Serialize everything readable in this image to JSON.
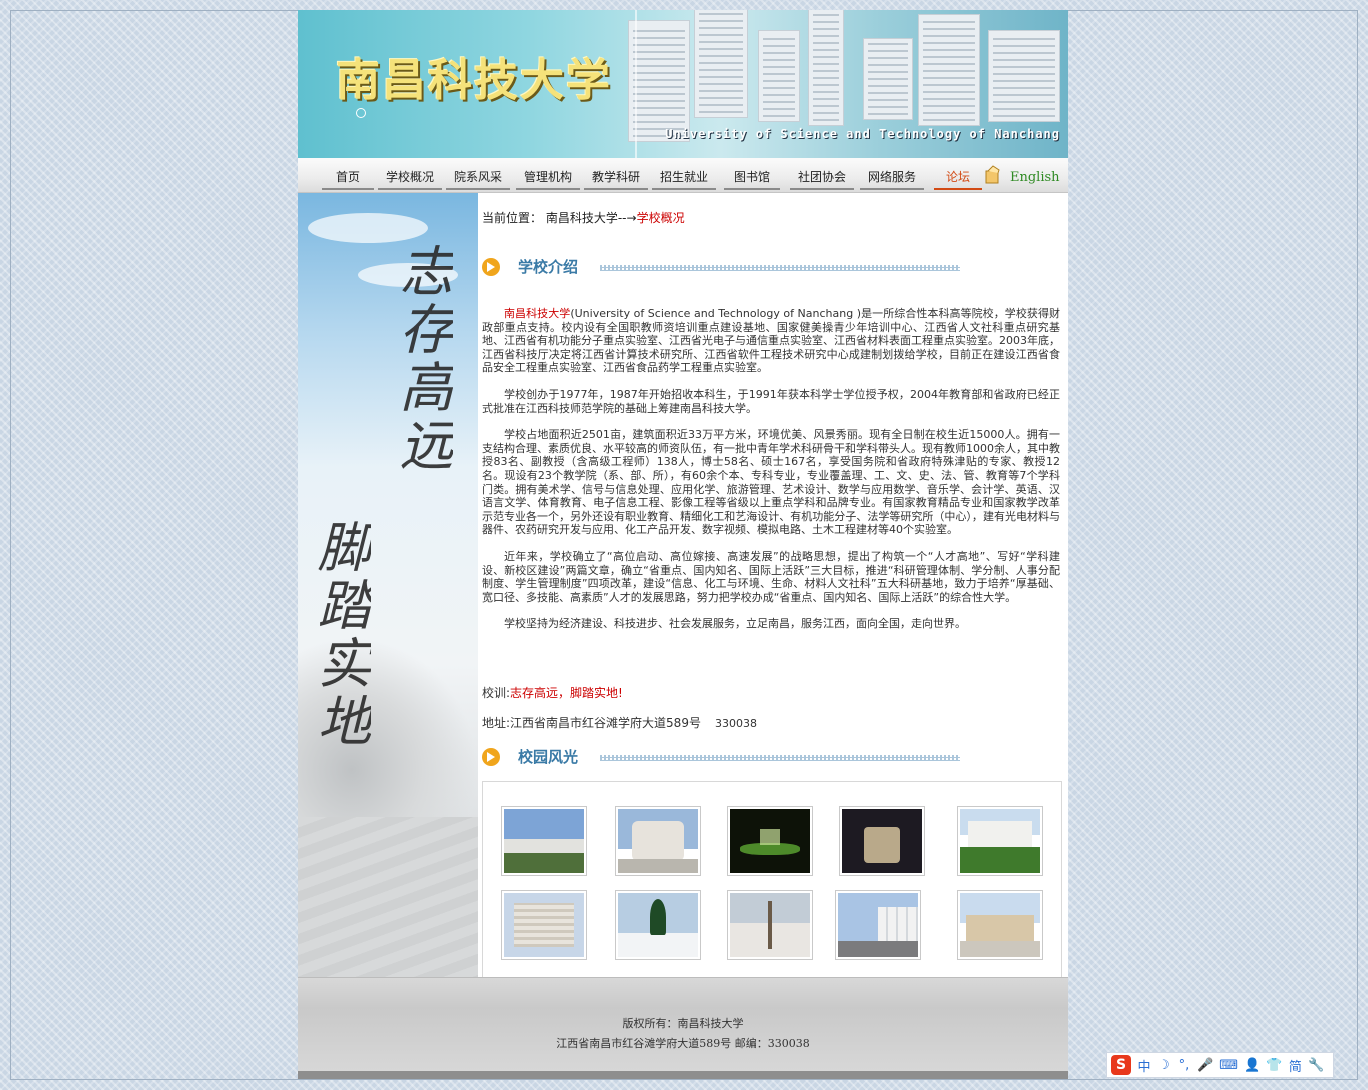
{
  "banner": {
    "title": "南昌科技大学",
    "title_en": "University of Science and Technology of Nanchang"
  },
  "nav": {
    "items": [
      "首页",
      "学校概况",
      "院系风采",
      "管理机构",
      "教学科研",
      "招生就业",
      "图书馆",
      "社团协会",
      "网络服务",
      "论坛"
    ],
    "english": "English"
  },
  "breadcrumb": {
    "label": "当前位置：",
    "parent": "南昌科技大学--→",
    "current": "学校概况"
  },
  "sections": {
    "intro_title": "学校介绍",
    "gallery_title": "校园风光"
  },
  "intro": {
    "school_name": "南昌科技大学",
    "p1_rest": "(University of Science and Technology of Nanchang )是一所综合性本科高等院校，学校获得财政部重点支持。校内设有全国职教师资培训重点建设基地、国家健美操青少年培训中心、江西省人文社科重点研究基地、江西省有机功能分子重点实验室、江西省光电子与通信重点实验室、江西省材料表面工程重点实验室。2003年底，江西省科技厅决定将江西省计算技术研究所、江西省软件工程技术研究中心成建制划拨给学校，目前正在建设江西省食品安全工程重点实验室、江西省食品药学工程重点实验室。",
    "p2": "学校创办于1977年，1987年开始招收本科生，于1991年获本科学士学位授予权，2004年教育部和省政府已经正式批准在江西科技师范学院的基础上筹建南昌科技大学。",
    "p3": "学校占地面积近2501亩，建筑面积近33万平方米，环境优美、风景秀丽。现有全日制在校生近15000人。拥有一支结构合理、素质优良、水平较高的师资队伍，有一批中青年学术科研骨干和学科带头人。现有教师1000余人，其中教授83名、副教授（含高级工程师）138人，博士58名、硕士167名，享受国务院和省政府特殊津贴的专家、教授12名。现设有23个教学院（系、部、所），有60余个本、专科专业，专业覆盖理、工、文、史、法、管、教育等7个学科门类。拥有美术学、信号与信息处理、应用化学、旅游管理、艺术设计、数学与应用数学、音乐学、会计学、英语、汉语言文学、体育教育、电子信息工程、影像工程等省级以上重点学科和品牌专业。有国家教育精品专业和国家教学改革示范专业各一个，另外还设有职业教育、精细化工和艺海设计、有机功能分子、法学等研究所（中心），建有光电材料与器件、农药研究开发与应用、化工产品开发、数字视频、模拟电路、土木工程建材等40个实验室。",
    "p4": "近年来，学校确立了“高位启动、高位嫁接、高速发展”的战略思想，提出了构筑一个“人才高地”、写好“学科建设、新校区建设”两篇文章，确立“省重点、国内知名、国际上活跃”三大目标，推进“科研管理体制、学分制、人事分配制度、学生管理制度”四项改革，建设“信息、化工与环境、生命、材料人文社科”五大科研基地，致力于培养“厚基础、宽口径、多技能、高素质”人才的发展思路，努力把学校办成“省重点、国内知名、国际上活跃”的综合性大学。",
    "p5": "学校坚持为经济建设、科技进步、社会发展服务，立足南昌，服务江西，面向全国，走向世界。"
  },
  "motto": {
    "label": "校训:",
    "value": "志存高远，脚踏实地!"
  },
  "address": {
    "label": "地址:江西省南昌市红谷滩学府大道589号",
    "zip": "330038"
  },
  "side": {
    "calligraphy_1": "志存高远",
    "calligraphy_2": "脚踏实地"
  },
  "gallery": {
    "rows": [
      [
        "campus-building",
        "stone-sculpture",
        "night-fountain",
        "night-sculpture",
        "garden-buildings"
      ],
      [
        "dormitory-blocks",
        "snow-tree",
        "snow-field",
        "snow-road-buildings",
        "sculpture-wall"
      ]
    ]
  },
  "footer": {
    "line1": "版权所有：南昌科技大学",
    "line2": "江西省南昌市红谷滩学府大道589号    邮编：330038"
  },
  "ime": {
    "logo": "S",
    "items": [
      "中",
      "☽",
      "°,",
      "🎤",
      "⌨",
      "👤",
      "👕",
      "简",
      "🔧"
    ]
  },
  "colors": {
    "accent_red": "#cc0000",
    "title_blue": "#3a7aa6",
    "nav_forum": "#d24a14",
    "english_green": "#2f8a23"
  }
}
